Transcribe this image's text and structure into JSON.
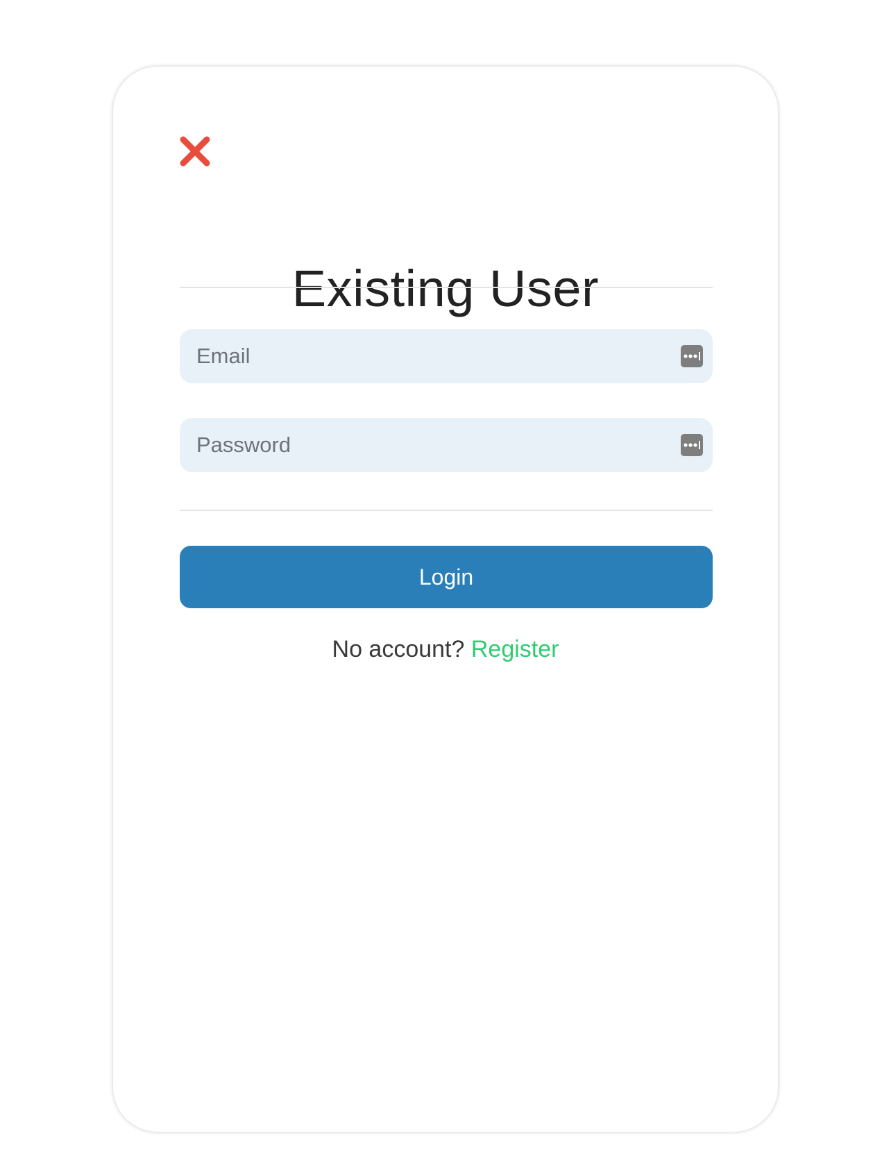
{
  "dialog": {
    "title": "Existing User"
  },
  "form": {
    "email": {
      "placeholder": "Email",
      "value": ""
    },
    "password": {
      "placeholder": "Password",
      "value": ""
    },
    "login_label": "Login"
  },
  "footer": {
    "prompt": "No account?",
    "register_label": "Register"
  },
  "icons": {
    "close": "close-icon",
    "password_manager": "password-manager-icon"
  },
  "colors": {
    "close": "#e74c3c",
    "primary_button": "#2a7fb8",
    "register_link": "#2ecc71",
    "field_background": "#e8f0f8"
  }
}
